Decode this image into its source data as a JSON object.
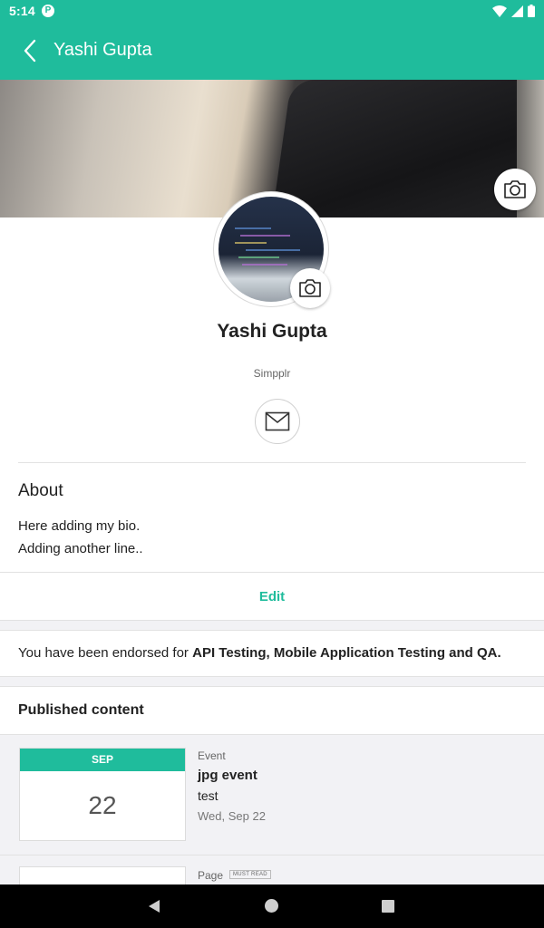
{
  "status_bar": {
    "time": "5:14",
    "app_icon_glyph": "P",
    "icons": [
      "wifi-icon",
      "signal-icon",
      "battery-icon"
    ]
  },
  "app_bar": {
    "title": "Yashi Gupta",
    "back_icon": "back-arrow-icon"
  },
  "profile": {
    "name": "Yashi Gupta",
    "company": "Simpplr",
    "cover_camera_icon": "camera-icon",
    "avatar_camera_icon": "camera-icon",
    "email_icon": "envelope-icon"
  },
  "about": {
    "title": "About",
    "bio_lines": [
      "Here adding my bio.",
      "Adding another line.."
    ],
    "edit_label": "Edit"
  },
  "endorsement": {
    "prefix": "You have been endorsed for ",
    "skills": "API Testing, Mobile Application Testing and QA."
  },
  "published": {
    "title": "Published content",
    "items": [
      {
        "type": "Event",
        "month": "SEP",
        "day": "22",
        "title": "jpg event",
        "subtitle": "test",
        "date": "Wed, Sep 22"
      },
      {
        "type": "Page",
        "badge": "MUST READ"
      }
    ]
  },
  "colors": {
    "accent": "#1fbc9c",
    "background": "#ffffff",
    "section_gap": "#f2f2f5"
  }
}
